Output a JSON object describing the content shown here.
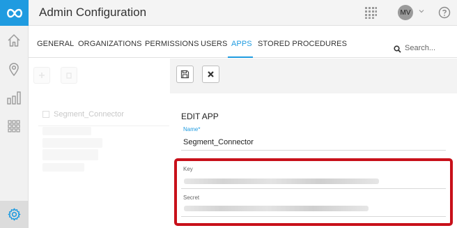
{
  "header": {
    "title": "Admin Configuration",
    "avatar_initials": "MV"
  },
  "tabs": [
    {
      "label": "GENERAL"
    },
    {
      "label": "ORGANIZATIONS"
    },
    {
      "label": "PERMISSIONS"
    },
    {
      "label": "USERS"
    },
    {
      "label": "APPS",
      "active": true
    },
    {
      "label": "STORED PROCEDURES"
    }
  ],
  "search": {
    "placeholder": "Search..."
  },
  "list": {
    "items": [
      {
        "label": "Segment_Connector"
      }
    ]
  },
  "form": {
    "title": "EDIT APP",
    "name_label": "Name*",
    "name_value": "Segment_Connector",
    "key_label": "Key",
    "secret_label": "Secret"
  },
  "colors": {
    "accent": "#1f9be0",
    "highlight": "#c8101a"
  }
}
